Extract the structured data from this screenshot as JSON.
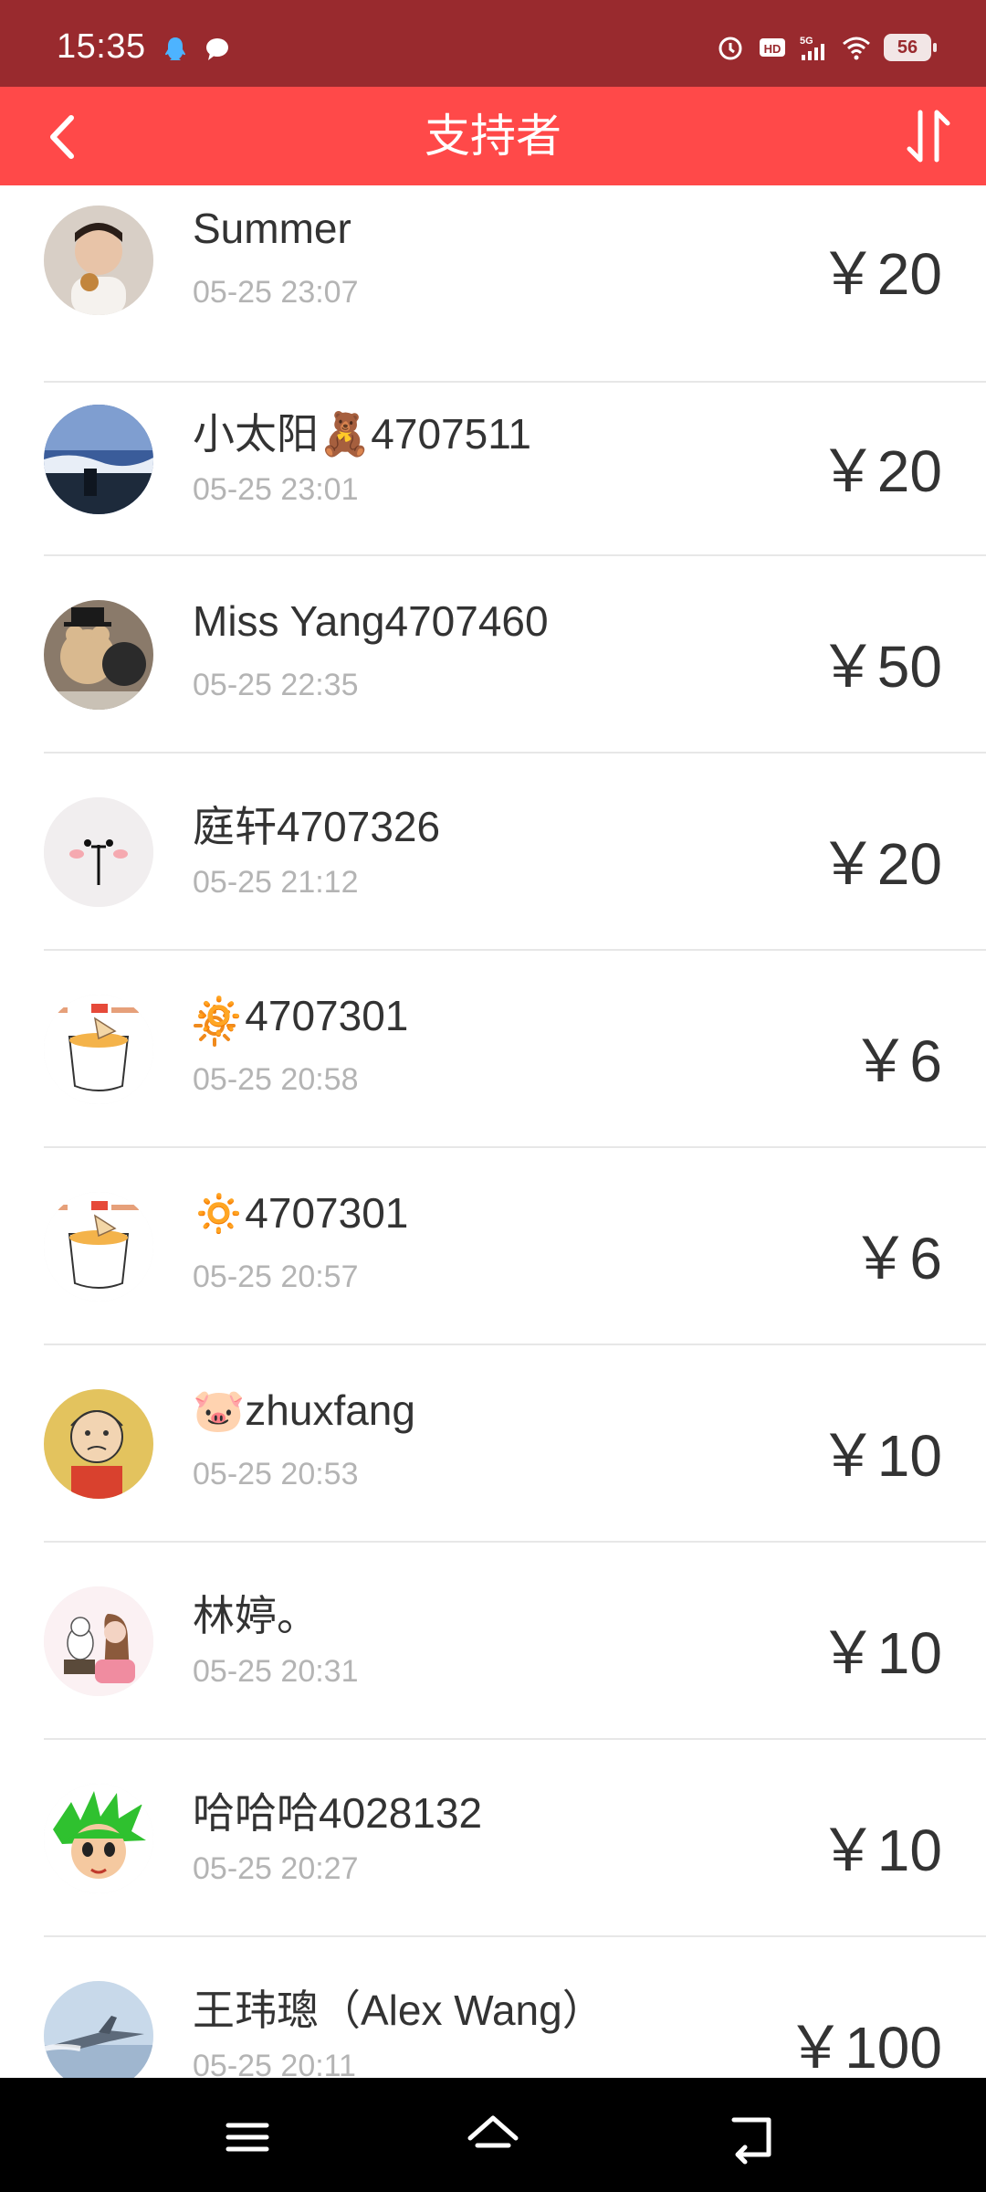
{
  "status_bar": {
    "time": "15:35",
    "battery": "56",
    "left_icons": [
      "qq-icon",
      "message-icon"
    ],
    "right_icons": [
      "alarm-icon",
      "hd-icon",
      "signal-5g-icon",
      "wifi-icon",
      "battery-icon"
    ]
  },
  "header": {
    "title": "支持者",
    "back_icon": "chevron-left-icon",
    "sort_icon": "sort-icon",
    "bg_color": "#ff4949"
  },
  "supporters": [
    {
      "name": "Summer",
      "time": "05-25 23:07",
      "amount": "￥20",
      "avatar": "baby-photo"
    },
    {
      "name": "小太阳🧸4707511",
      "time": "05-25 23:01",
      "amount": "￥20",
      "avatar": "sea-photo"
    },
    {
      "name": "Miss Yang4707460",
      "time": "05-25 22:35",
      "amount": "￥50",
      "avatar": "teddy-bear-photo"
    },
    {
      "name": "庭轩4707326",
      "time": "05-25 21:12",
      "amount": "￥20",
      "avatar": "cute-face"
    },
    {
      "name": "🔅4707301",
      "time": "05-25 20:58",
      "amount": "￥6",
      "avatar": "noodle-bowl-logo"
    },
    {
      "name": "🔅4707301",
      "time": "05-25 20:57",
      "amount": "￥6",
      "avatar": "noodle-bowl-logo"
    },
    {
      "name": "🐷zhuxfang",
      "time": "05-25 20:53",
      "amount": "￥10",
      "avatar": "cartoon-boy"
    },
    {
      "name": "林婷。",
      "time": "05-25 20:31",
      "amount": "￥10",
      "avatar": "girl-with-cat"
    },
    {
      "name": "哈哈哈4028132",
      "time": "05-25 20:27",
      "amount": "￥10",
      "avatar": "green-hair-cartoon"
    },
    {
      "name": "王玮璁（Alex Wang）",
      "time": "05-25 20:11",
      "amount": "￥100",
      "avatar": "jet-photo"
    }
  ],
  "nav_bar": {
    "icons": [
      "menu-icon",
      "home-icon",
      "back-icon"
    ]
  }
}
